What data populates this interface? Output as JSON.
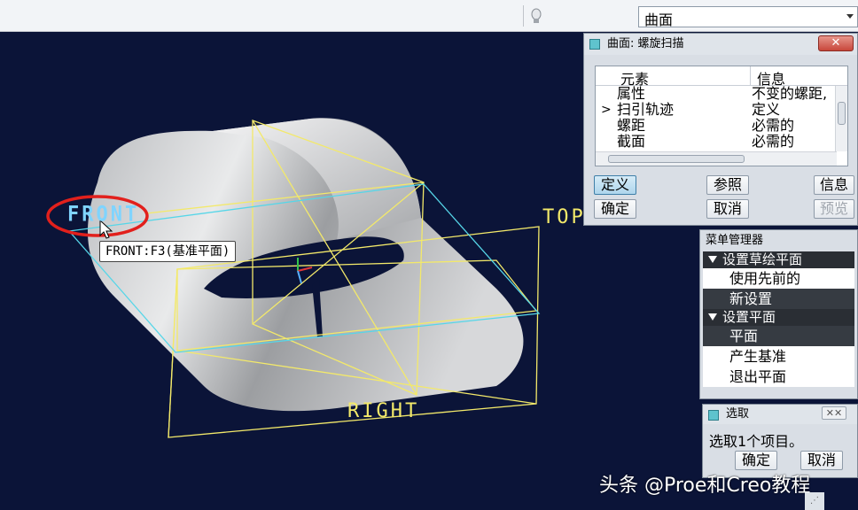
{
  "toolbar": {
    "filter_value": "曲面",
    "icons": [
      "bulb-icon",
      "dropdown-arrow-icon"
    ]
  },
  "viewport": {
    "labels": {
      "front": "FRONT",
      "top": "TOP",
      "right": "RIGHT"
    },
    "tooltip": "FRONT:F3(基准平面)",
    "colors": {
      "background": "#0b1438",
      "datum_plane": "#f3e96a",
      "front_plane": "#56d6e8",
      "highlight_ellipse": "#e2201c"
    }
  },
  "sweep_dialog": {
    "title": "曲面: 螺旋扫描",
    "close_label": "✕",
    "columns": [
      "元素",
      "信息"
    ],
    "rows": [
      {
        "element": "属性",
        "info": "不变的螺距,",
        "current": false
      },
      {
        "element": "扫引轨迹",
        "info": "定义",
        "current": true
      },
      {
        "element": "螺距",
        "info": "必需的",
        "current": false
      },
      {
        "element": "截面",
        "info": "必需的",
        "current": false
      }
    ],
    "current_marker": ">",
    "buttons": {
      "define": "定义",
      "refs": "参照",
      "info": "信息",
      "ok": "确定",
      "cancel": "取消",
      "preview": "预览"
    }
  },
  "menu_manager": {
    "title": "菜单管理器",
    "section1": "设置草绘平面",
    "section1_items": [
      {
        "label": "使用先前的",
        "selected": false
      },
      {
        "label": "新设置",
        "selected": true
      }
    ],
    "section2": "设置平面",
    "section2_items": [
      {
        "label": "平面",
        "selected": true
      },
      {
        "label": "产生基准",
        "selected": false
      },
      {
        "label": "退出平面",
        "selected": false
      }
    ]
  },
  "select_dialog": {
    "title": "选取",
    "close_label": "✕✕",
    "message": "选取1个项目。",
    "ok": "确定",
    "cancel": "取消"
  },
  "watermark": "头条 @Proe和Creo教程"
}
